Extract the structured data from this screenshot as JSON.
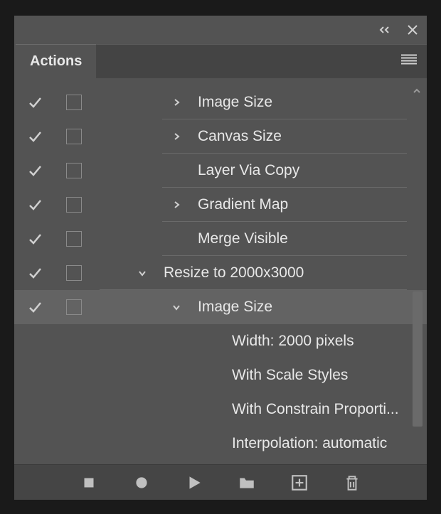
{
  "panel": {
    "title": "Actions"
  },
  "actions": [
    {
      "indent": 0,
      "checked": true,
      "hasToggle": true,
      "expand": "right",
      "label": "Image Size",
      "selected": false,
      "border": true
    },
    {
      "indent": 0,
      "checked": true,
      "hasToggle": true,
      "expand": "right",
      "label": "Canvas Size",
      "selected": false,
      "border": true
    },
    {
      "indent": 0,
      "checked": true,
      "hasToggle": true,
      "expand": "none",
      "label": "Layer Via Copy",
      "selected": false,
      "border": true
    },
    {
      "indent": 0,
      "checked": true,
      "hasToggle": true,
      "expand": "right",
      "label": "Gradient Map",
      "selected": false,
      "border": true
    },
    {
      "indent": 0,
      "checked": true,
      "hasToggle": true,
      "expand": "none",
      "label": "Merge Visible",
      "selected": false,
      "border": true
    },
    {
      "indent": -1,
      "checked": true,
      "hasToggle": true,
      "expand": "down",
      "label": "Resize to 2000x3000",
      "selected": false,
      "border": true
    },
    {
      "indent": 0,
      "checked": true,
      "hasToggle": true,
      "expand": "down",
      "label": "Image Size",
      "selected": true,
      "border": false
    },
    {
      "indent": 1,
      "checked": false,
      "hasToggle": false,
      "expand": "none",
      "label": "Width: 2000 pixels",
      "selected": false,
      "border": false
    },
    {
      "indent": 1,
      "checked": false,
      "hasToggle": false,
      "expand": "none",
      "label": "With Scale Styles",
      "selected": false,
      "border": false
    },
    {
      "indent": 1,
      "checked": false,
      "hasToggle": false,
      "expand": "none",
      "label": "With Constrain Proporti...",
      "selected": false,
      "border": false
    },
    {
      "indent": 1,
      "checked": false,
      "hasToggle": false,
      "expand": "none",
      "label": "Interpolation: automatic",
      "selected": false,
      "border": false
    }
  ],
  "footer_buttons": [
    "stop",
    "record",
    "play",
    "folder",
    "new",
    "delete"
  ]
}
